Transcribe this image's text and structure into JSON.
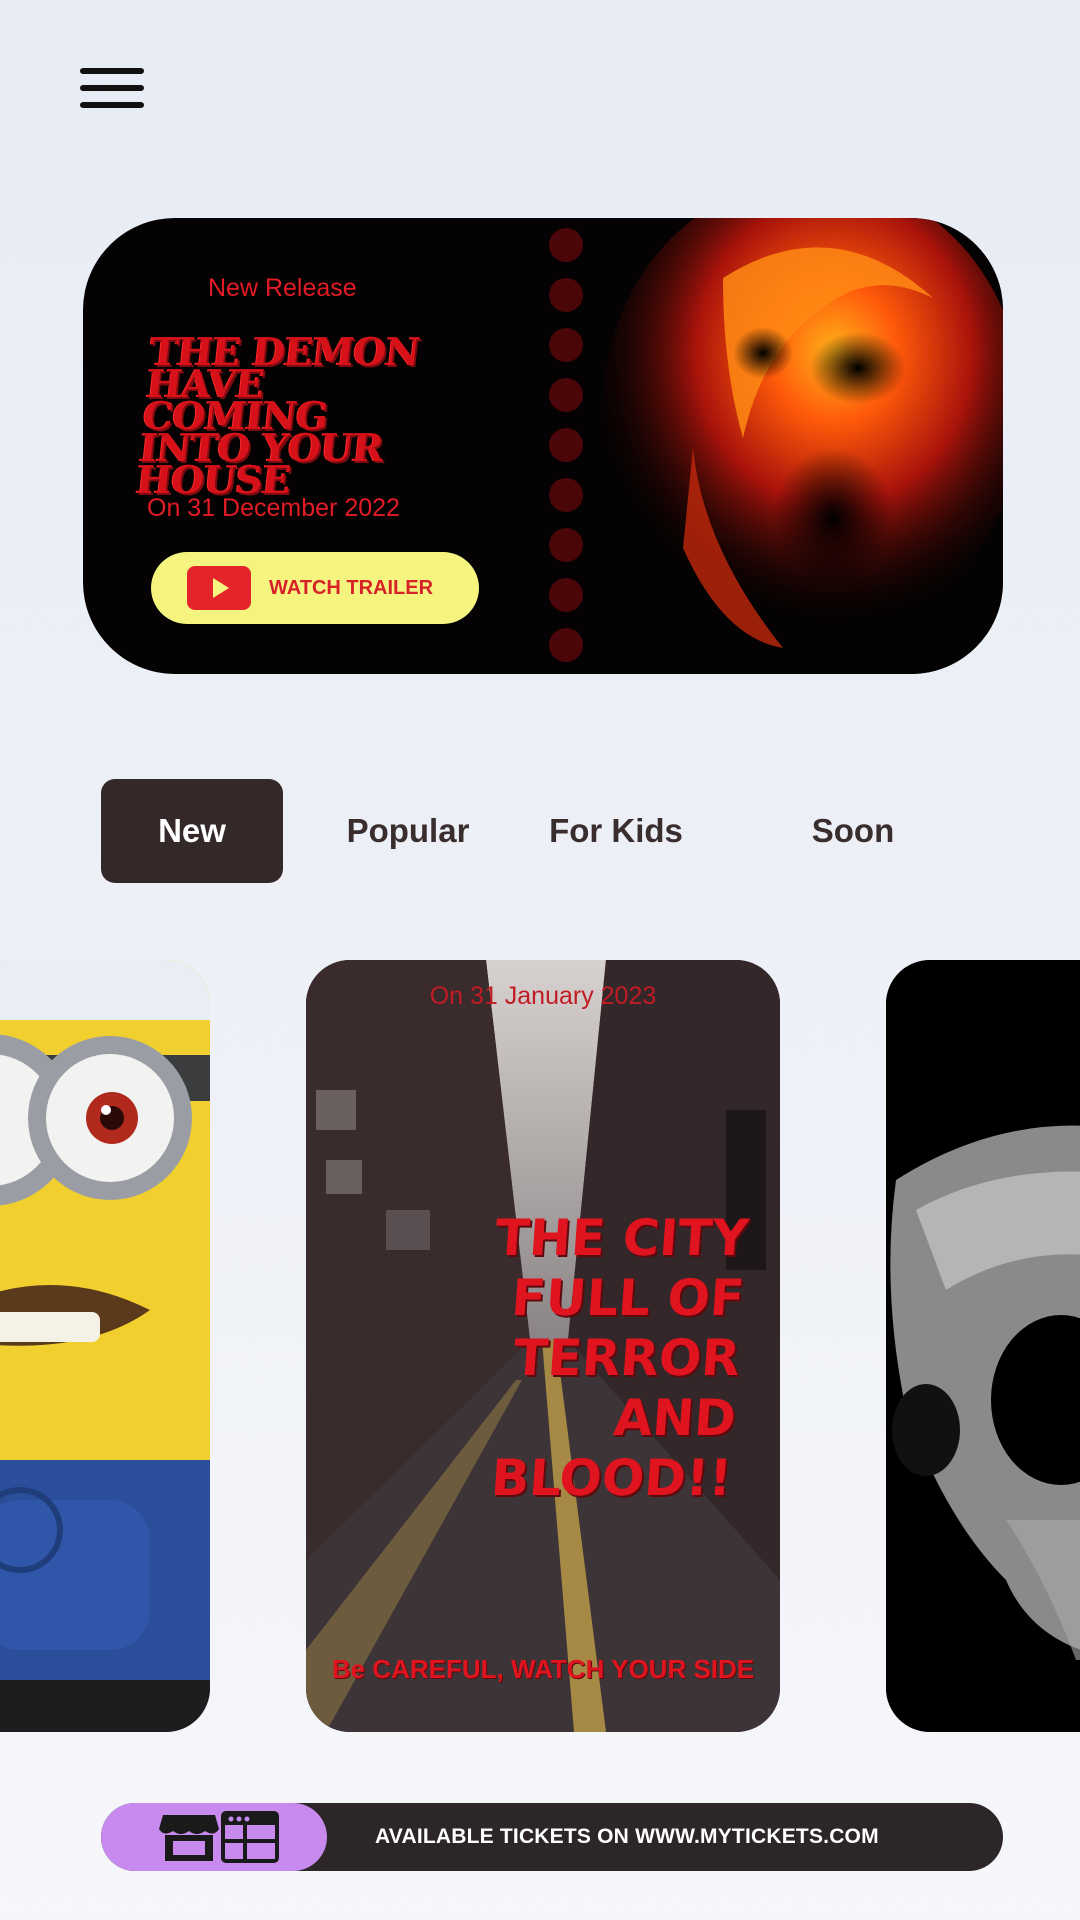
{
  "hero": {
    "kicker": "New Release",
    "title": "THE DEMON HAVE COMING INTO YOUR HOUSE",
    "date": "On 31 December 2022",
    "trailer_label": "WATCH TRAILER"
  },
  "tabs": [
    {
      "label": "New",
      "active": true
    },
    {
      "label": "Popular",
      "active": false
    },
    {
      "label": "For Kids",
      "active": false
    },
    {
      "label": "Soon",
      "active": false
    }
  ],
  "featured_card": {
    "date": "On 31 January 2023",
    "headline": "THE CITY FULL OF TERROR AND BLOOD!!",
    "tagline": "Be CAREFUL, WATCH YOUR SIDE"
  },
  "footer": {
    "tickets_text": "AVAILABLE TICKETS ON WWW.MYTICKETS.COM"
  },
  "icons": {
    "menu": "hamburger-menu-icon",
    "trailer": "youtube-play-icon",
    "store": "store-icon",
    "browser": "browser-window-icon"
  },
  "colors": {
    "accent_red": "#e31b26",
    "trailer_button": "#f4f47f",
    "active_tab": "#342828",
    "ticket_icon_bg": "#c98aef",
    "ticket_bar": "#2d2628"
  }
}
